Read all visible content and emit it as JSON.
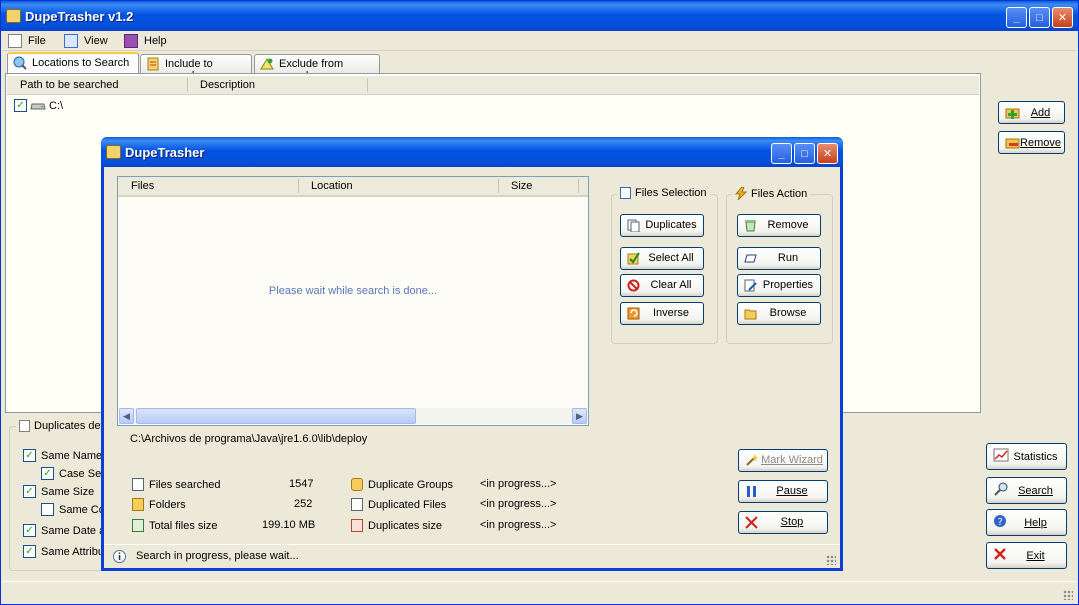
{
  "main": {
    "title": "DupeTrasher v1.2",
    "menu": {
      "file": "File",
      "view": "View",
      "help": "Help"
    },
    "tabs": [
      "Locations to Search",
      "Include to search",
      "Exclude from search"
    ],
    "columns": {
      "path": "Path to be searched",
      "description": "Description"
    },
    "locations": [
      {
        "checked": true,
        "path": "C:\\"
      }
    ],
    "buttons": {
      "add": "Add",
      "remove": "Remove",
      "statistics": "Statistics",
      "search": "Search",
      "help": "Help",
      "exit": "Exit"
    },
    "duplicates_group": {
      "legend": "Duplicates def",
      "options": [
        {
          "label": "Same Name",
          "checked": true
        },
        {
          "label": "Case Sen",
          "checked": true
        },
        {
          "label": "Same Size",
          "checked": true
        },
        {
          "label": "Same Con",
          "checked": false
        },
        {
          "label": "Same Date a",
          "checked": true
        },
        {
          "label": "Same Attribut",
          "checked": true
        }
      ]
    }
  },
  "dialog": {
    "title": "DupeTrasher",
    "columns": {
      "files": "Files",
      "location": "Location",
      "size": "Size"
    },
    "wait_message": "Please wait while search is done...",
    "files_selection": {
      "legend": "Files Selection",
      "buttons": [
        "Duplicates",
        "Select All",
        "Clear All",
        "Inverse"
      ]
    },
    "files_action": {
      "legend": "Files Action",
      "buttons": [
        "Remove",
        "Run",
        "Properties",
        "Browse"
      ]
    },
    "current_path": "C:\\Archivos de programa\\Java\\jre1.6.0\\lib\\deploy",
    "stats": {
      "files_searched_label": "Files searched",
      "files_searched": "1547",
      "folders_label": "Folders",
      "folders": "252",
      "total_size_label": "Total files size",
      "total_size": "199.10 MB",
      "dup_groups_label": "Duplicate Groups",
      "dup_groups": "<in progress...>",
      "dup_files_label": "Duplicated Files",
      "dup_files": "<in progress...>",
      "dup_size_label": "Duplicates size",
      "dup_size": "<in progress...>"
    },
    "control_buttons": {
      "mark_wizard": "Mark Wizard",
      "pause": "Pause",
      "stop": "Stop"
    },
    "status": "Search in progress, please wait..."
  }
}
